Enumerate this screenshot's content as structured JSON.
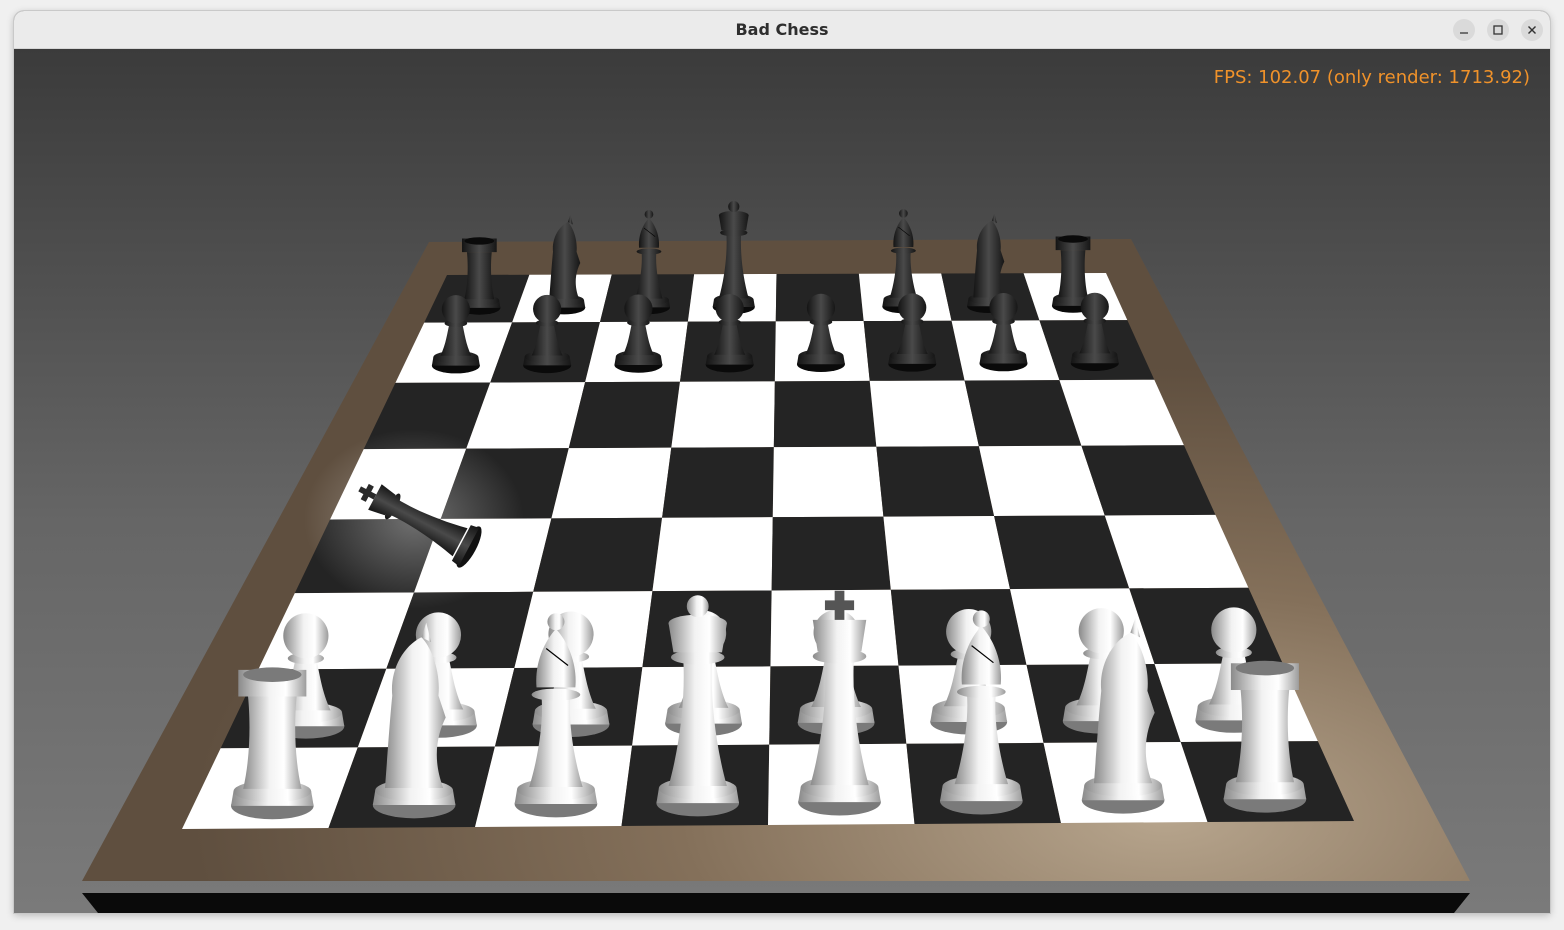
{
  "window": {
    "title": "Bad Chess",
    "buttons": [
      "minimize",
      "maximize",
      "close"
    ]
  },
  "hud": {
    "fps_text": "FPS: 102.07 (only render: 1713.92)"
  },
  "colors": {
    "hud_text": "#f0922a",
    "board_frame": "#8e7b61",
    "dark_square": "#242424",
    "light_square": "#ffffff",
    "black_piece": "#2b2b2b",
    "white_piece": "#dcdcdc"
  },
  "board": {
    "files": 8,
    "ranks": 8
  },
  "pieces": [
    {
      "type": "rook",
      "color": "black",
      "file": 0,
      "rank": 7
    },
    {
      "type": "knight",
      "color": "black",
      "file": 1,
      "rank": 7
    },
    {
      "type": "bishop",
      "color": "black",
      "file": 2,
      "rank": 7
    },
    {
      "type": "queen",
      "color": "black",
      "file": 3,
      "rank": 7
    },
    {
      "type": "bishop",
      "color": "black",
      "file": 5,
      "rank": 7
    },
    {
      "type": "knight",
      "color": "black",
      "file": 6,
      "rank": 7
    },
    {
      "type": "rook",
      "color": "black",
      "file": 7,
      "rank": 7
    },
    {
      "type": "pawn",
      "color": "black",
      "file": 0,
      "rank": 6
    },
    {
      "type": "pawn",
      "color": "black",
      "file": 1,
      "rank": 6
    },
    {
      "type": "pawn",
      "color": "black",
      "file": 2,
      "rank": 6
    },
    {
      "type": "pawn",
      "color": "black",
      "file": 3,
      "rank": 6
    },
    {
      "type": "pawn",
      "color": "black",
      "file": 4,
      "rank": 6
    },
    {
      "type": "pawn",
      "color": "black",
      "file": 5,
      "rank": 6
    },
    {
      "type": "pawn",
      "color": "black",
      "file": 6,
      "rank": 6
    },
    {
      "type": "pawn",
      "color": "black",
      "file": 7,
      "rank": 6
    },
    {
      "type": "king",
      "color": "black",
      "state": "toppled"
    },
    {
      "type": "pawn",
      "color": "white",
      "file": 0,
      "rank": 1
    },
    {
      "type": "pawn",
      "color": "white",
      "file": 1,
      "rank": 1
    },
    {
      "type": "pawn",
      "color": "white",
      "file": 2,
      "rank": 1
    },
    {
      "type": "pawn",
      "color": "white",
      "file": 3,
      "rank": 1
    },
    {
      "type": "pawn",
      "color": "white",
      "file": 4,
      "rank": 1
    },
    {
      "type": "pawn",
      "color": "white",
      "file": 5,
      "rank": 1
    },
    {
      "type": "pawn",
      "color": "white",
      "file": 6,
      "rank": 1
    },
    {
      "type": "pawn",
      "color": "white",
      "file": 7,
      "rank": 1
    },
    {
      "type": "rook",
      "color": "white",
      "file": 0,
      "rank": 0
    },
    {
      "type": "knight",
      "color": "white",
      "file": 1,
      "rank": 0
    },
    {
      "type": "bishop",
      "color": "white",
      "file": 2,
      "rank": 0
    },
    {
      "type": "queen",
      "color": "white",
      "file": 3,
      "rank": 0
    },
    {
      "type": "king",
      "color": "white",
      "file": 4,
      "rank": 0
    },
    {
      "type": "bishop",
      "color": "white",
      "file": 5,
      "rank": 0
    },
    {
      "type": "knight",
      "color": "white",
      "file": 6,
      "rank": 0
    },
    {
      "type": "rook",
      "color": "white",
      "file": 7,
      "rank": 0
    }
  ]
}
